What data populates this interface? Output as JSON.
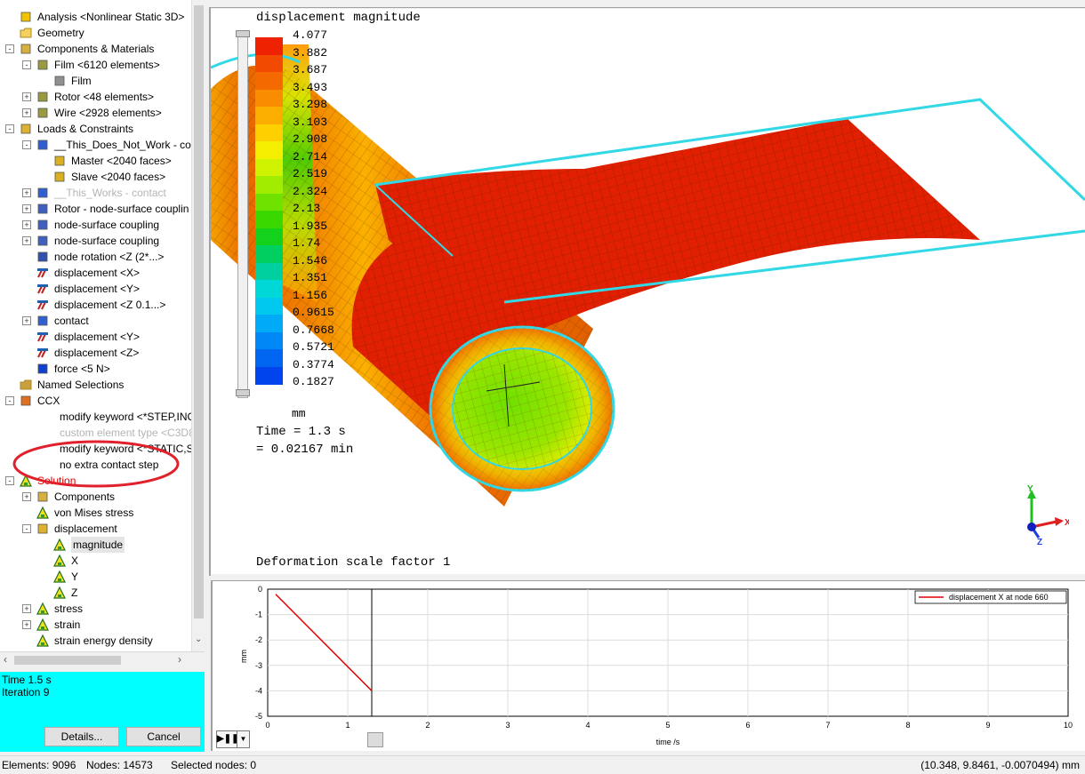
{
  "tree": {
    "items": [
      {
        "label": "Analysis <Nonlinear Static 3D>",
        "depth": 0,
        "exp": "",
        "icon": "analysis-icon"
      },
      {
        "label": "Geometry",
        "depth": 0,
        "exp": "",
        "icon": "folder-icon"
      },
      {
        "label": "Components & Materials",
        "depth": 0,
        "exp": "-",
        "icon": "components-icon"
      },
      {
        "label": "Film <6120 elements>",
        "depth": 1,
        "exp": "-",
        "icon": "component-icon"
      },
      {
        "label": "Film",
        "depth": 2,
        "exp": "",
        "icon": "material-icon"
      },
      {
        "label": "Rotor <48 elements>",
        "depth": 1,
        "exp": "+",
        "icon": "component-icon"
      },
      {
        "label": "Wire <2928 elements>",
        "depth": 1,
        "exp": "+",
        "icon": "component-icon"
      },
      {
        "label": "Loads & Constraints",
        "depth": 0,
        "exp": "-",
        "icon": "loads-icon"
      },
      {
        "label": "__This_Does_Not_Work - con",
        "depth": 1,
        "exp": "-",
        "icon": "contact-icon"
      },
      {
        "label": "Master <2040 faces>",
        "depth": 2,
        "exp": "",
        "icon": "faces-icon"
      },
      {
        "label": "Slave <2040 faces>",
        "depth": 2,
        "exp": "",
        "icon": "faces-icon"
      },
      {
        "label": "__This_Works - contact",
        "depth": 1,
        "exp": "+",
        "icon": "contact-icon",
        "style": "grey"
      },
      {
        "label": "Rotor - node-surface couplin",
        "depth": 1,
        "exp": "+",
        "icon": "coupling-icon"
      },
      {
        "label": "node-surface coupling",
        "depth": 1,
        "exp": "+",
        "icon": "coupling-icon"
      },
      {
        "label": "node-surface coupling",
        "depth": 1,
        "exp": "+",
        "icon": "coupling-icon"
      },
      {
        "label": "node rotation <Z (2*...>",
        "depth": 1,
        "exp": "",
        "icon": "rotation-icon"
      },
      {
        "label": "displacement <X>",
        "depth": 1,
        "exp": "",
        "icon": "displacement-icon"
      },
      {
        "label": "displacement <Y>",
        "depth": 1,
        "exp": "",
        "icon": "displacement-icon"
      },
      {
        "label": "displacement <Z 0.1...>",
        "depth": 1,
        "exp": "",
        "icon": "displacement-icon"
      },
      {
        "label": "contact",
        "depth": 1,
        "exp": "+",
        "icon": "contact-icon"
      },
      {
        "label": "displacement <Y>",
        "depth": 1,
        "exp": "",
        "icon": "displacement-icon"
      },
      {
        "label": "displacement <Z>",
        "depth": 1,
        "exp": "",
        "icon": "displacement-icon"
      },
      {
        "label": "force <5 N>",
        "depth": 1,
        "exp": "",
        "icon": "force-icon"
      },
      {
        "label": "Named Selections",
        "depth": 0,
        "exp": "",
        "icon": "selections-icon"
      },
      {
        "label": "CCX",
        "depth": 0,
        "exp": "-",
        "icon": "ccx-icon"
      },
      {
        "label": "modify keyword <*STEP,INC:",
        "depth": 1,
        "exp": "",
        "icon": ""
      },
      {
        "label": "custom element type <C3D8",
        "depth": 1,
        "exp": "",
        "icon": "",
        "style": "grey"
      },
      {
        "label": "modify keyword <*STATIC,SO",
        "depth": 1,
        "exp": "",
        "icon": ""
      },
      {
        "label": "no extra contact step",
        "depth": 1,
        "exp": "",
        "icon": ""
      },
      {
        "label": "Solution",
        "depth": 0,
        "exp": "-",
        "icon": "solution-icon",
        "style": "red"
      },
      {
        "label": "Components",
        "depth": 1,
        "exp": "+",
        "icon": "components-icon"
      },
      {
        "label": "von Mises stress",
        "depth": 1,
        "exp": "",
        "icon": "result-icon"
      },
      {
        "label": "displacement",
        "depth": 1,
        "exp": "-",
        "icon": "result-group-icon"
      },
      {
        "label": "magnitude",
        "depth": 2,
        "exp": "",
        "icon": "result-icon",
        "style": "sel"
      },
      {
        "label": "X",
        "depth": 2,
        "exp": "",
        "icon": "result-icon"
      },
      {
        "label": "Y",
        "depth": 2,
        "exp": "",
        "icon": "result-icon"
      },
      {
        "label": "Z",
        "depth": 2,
        "exp": "",
        "icon": "result-icon"
      },
      {
        "label": "stress",
        "depth": 1,
        "exp": "+",
        "icon": "result-icon"
      },
      {
        "label": "strain",
        "depth": 1,
        "exp": "+",
        "icon": "result-icon"
      },
      {
        "label": "strain energy density",
        "depth": 1,
        "exp": "",
        "icon": "result-icon"
      }
    ]
  },
  "status_panel": {
    "time": "Time 1.5 s",
    "iteration": "Iteration 9",
    "details_label": "Details...",
    "cancel_label": "Cancel"
  },
  "view": {
    "result_title": "displacement magnitude",
    "legend_values": [
      "4.077",
      "3.882",
      "3.687",
      "3.493",
      "3.298",
      "3.103",
      "2.908",
      "2.714",
      "2.519",
      "2.324",
      "2.13",
      "1.935",
      "1.74",
      "1.546",
      "1.351",
      "1.156",
      "0.9615",
      "0.7668",
      "0.5721",
      "0.3774",
      "0.1827"
    ],
    "legend_colors": [
      "#ee2200",
      "#f24a00",
      "#f56a00",
      "#f98c00",
      "#fbae00",
      "#ffd000",
      "#f4ee00",
      "#cff200",
      "#a2ec00",
      "#6fe200",
      "#3bd800",
      "#14d21c",
      "#00d060",
      "#00d0a0",
      "#00d8d8",
      "#00c8ee",
      "#00aaf6",
      "#0088f6",
      "#0066f2",
      "#0044ee",
      "#0022e6"
    ],
    "unit": "mm",
    "time_line1": "Time = 1.3 s",
    "time_line2": "= 0.02167 min",
    "scale_factor": "Deformation scale factor 1",
    "colors": {
      "film": "#e02000",
      "rotor_outer": "#f07800",
      "wire_edge": "#32d8e6"
    }
  },
  "axes_triad": {
    "x": "X",
    "y": "Y",
    "z": "Z"
  },
  "plot": {
    "legend_label": "displacement X at node 660",
    "ylabel": "mm",
    "xlabel": "time /s",
    "current_time": 1.3
  },
  "chart_data": {
    "type": "line",
    "series": [
      {
        "name": "displacement X at node 660",
        "x": [
          0.1,
          1.3
        ],
        "y": [
          -0.2,
          -4.0
        ]
      }
    ],
    "xlim": [
      0,
      10
    ],
    "ylim": [
      -5,
      0
    ],
    "xticks": [
      "0",
      "1",
      "2",
      "3",
      "4",
      "5",
      "6",
      "7",
      "8",
      "9",
      "10"
    ],
    "yticks": [
      "0",
      "-1",
      "-2",
      "-3",
      "-4",
      "-5"
    ],
    "xlabel": "time /s",
    "ylabel": "mm",
    "grid": true,
    "legend": "top-right"
  },
  "statusbar": {
    "elements": "Elements: 9096",
    "nodes": "Nodes: 14573",
    "selected": "Selected nodes: 0",
    "coords": "(10.348, 9.8461, -0.0070494) mm"
  }
}
